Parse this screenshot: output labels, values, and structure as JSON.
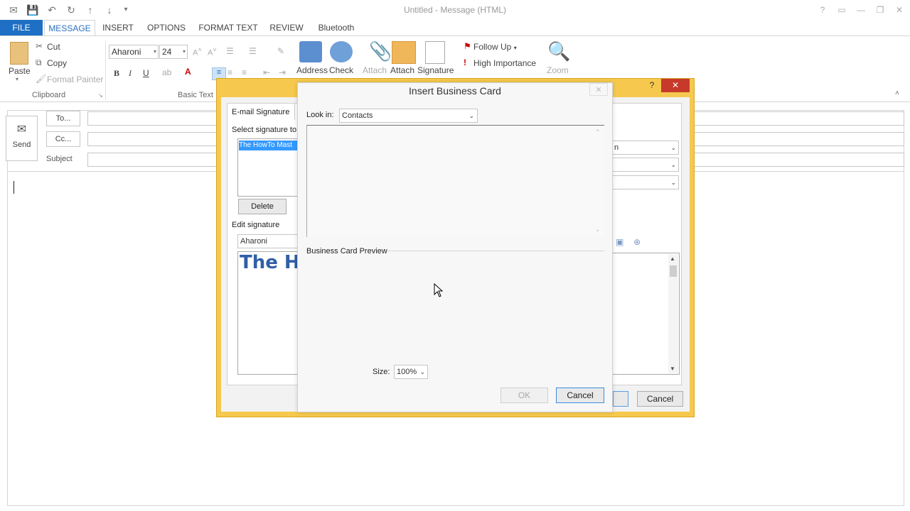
{
  "window": {
    "title": "Untitled - Message (HTML)"
  },
  "tabs": [
    {
      "label": "FILE"
    },
    {
      "label": "MESSAGE"
    },
    {
      "label": "INSERT"
    },
    {
      "label": "OPTIONS"
    },
    {
      "label": "FORMAT TEXT"
    },
    {
      "label": "REVIEW"
    },
    {
      "label": "Bluetooth"
    }
  ],
  "ribbon": {
    "clipboard": {
      "paste": "Paste",
      "cut": "Cut",
      "copy": "Copy",
      "format_painter": "Format Painter",
      "label": "Clipboard"
    },
    "basic_text": {
      "font": "Aharoni",
      "size": "24",
      "bold": "B",
      "italic": "I",
      "underline": "U",
      "label": "Basic Text"
    },
    "names": {
      "address": "Address",
      "check": "Check"
    },
    "include": {
      "attach": "Attach",
      "attach2": "Attach",
      "signature": "Signature"
    },
    "tags": {
      "follow_up": "Follow Up",
      "high_importance": "High Importance"
    },
    "zoom": {
      "label": "Zoom"
    }
  },
  "message": {
    "send": "Send",
    "to": "To...",
    "cc": "Cc...",
    "subject": "Subject"
  },
  "signatures_dialog": {
    "tab_label": "E-mail Signature",
    "select_label": "Select signature to",
    "selected_item": "The HowTo Mast",
    "delete_btn": "Delete",
    "edit_label": "Edit signature",
    "font": "Aharoni",
    "preview_text": "The H",
    "field_partial": "n",
    "cancel_btn": "Cancel"
  },
  "business_card_dialog": {
    "title": "Insert Business Card",
    "look_in_label": "Look in:",
    "look_in_value": "Contacts",
    "preview_label": "Business Card Preview",
    "size_label": "Size:",
    "size_value": "100%",
    "ok_btn": "OK",
    "cancel_btn": "Cancel"
  },
  "colors": {
    "accent": "#1f6fc5",
    "dialog_frame": "#f6c94e",
    "selection": "#3399ff"
  }
}
